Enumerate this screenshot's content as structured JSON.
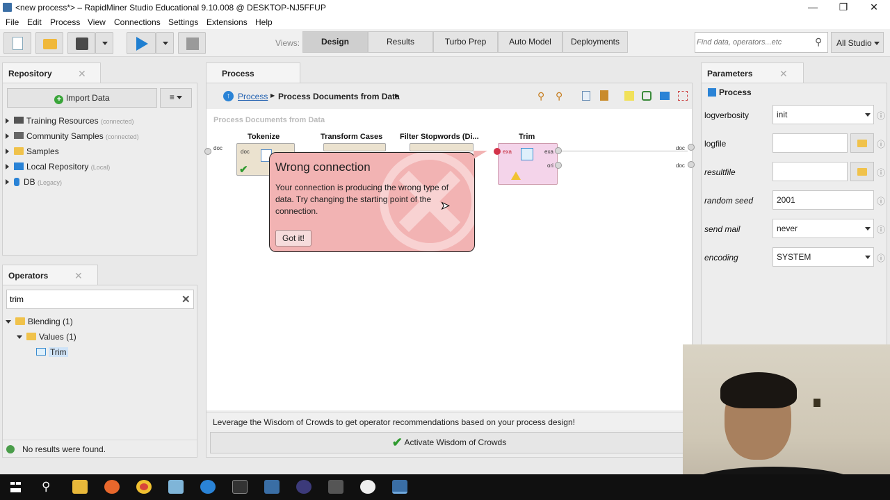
{
  "window": {
    "title": "<new process*> – RapidMiner Studio Educational 9.10.008 @ DESKTOP-NJ5FFUP",
    "controls": [
      "minimize-icon",
      "restore-icon",
      "close-icon"
    ]
  },
  "menu": [
    "File",
    "Edit",
    "Process",
    "View",
    "Connections",
    "Settings",
    "Extensions",
    "Help"
  ],
  "toolbar": {
    "views_label": "Views:",
    "views": [
      "Design",
      "Results",
      "Turbo Prep",
      "Auto Model",
      "Deployments"
    ],
    "active_view": "Design",
    "search_placeholder": "Find data, operators...etc",
    "scope": "All Studio"
  },
  "repository": {
    "title": "Repository",
    "import_label": "Import Data",
    "items": [
      {
        "label": "Training Resources",
        "note": "(connected)",
        "icon": "training-resources-icon"
      },
      {
        "label": "Community Samples",
        "note": "(connected)",
        "icon": "community-samples-icon"
      },
      {
        "label": "Samples",
        "note": "",
        "icon": "folder-icon"
      },
      {
        "label": "Local Repository",
        "note": "(Local)",
        "icon": "local-repository-icon"
      },
      {
        "label": "DB",
        "note": "(Legacy)",
        "icon": "database-icon"
      }
    ]
  },
  "operators": {
    "title": "Operators",
    "search_value": "trim",
    "tree": [
      {
        "label": "Blending (1)",
        "level": 0,
        "icon": "folder-icon"
      },
      {
        "label": "Values (1)",
        "level": 1,
        "icon": "folder-icon"
      },
      {
        "label": "Trim",
        "level": 2,
        "icon": "trim-operator-icon"
      }
    ],
    "status": "No results were found."
  },
  "process": {
    "tab": "Process",
    "breadcrumb": [
      "Process",
      "Process Documents from Data"
    ],
    "canvas_label": "Process Documents from Data",
    "operators": [
      "Tokenize",
      "Transform Cases",
      "Filter Stopwords (Di...",
      "Trim"
    ],
    "port_labels": {
      "doc": "doc",
      "exa": "exa",
      "ori": "ori"
    },
    "tooltip": {
      "title": "Wrong connection",
      "body": "Your connection is producing the wrong type of data. Try changing the starting point of the connection.",
      "button": "Got it!"
    },
    "wisdom_text": "Leverage the Wisdom of Crowds to get operator recommendations based on your process design!",
    "wisdom_button": "Activate Wisdom of Crowds"
  },
  "parameters": {
    "title": "Parameters",
    "operator": "Process",
    "rows": [
      {
        "label": "logverbosity",
        "value": "init",
        "type": "select",
        "italic": false
      },
      {
        "label": "logfile",
        "value": "",
        "type": "file",
        "italic": false
      },
      {
        "label": "resultfile",
        "value": "",
        "type": "file",
        "italic": true
      },
      {
        "label": "random seed",
        "value": "2001",
        "type": "text",
        "italic": true
      },
      {
        "label": "send mail",
        "value": "never",
        "type": "select",
        "italic": true
      },
      {
        "label": "encoding",
        "value": "SYSTEM",
        "type": "select",
        "italic": true
      }
    ]
  },
  "colors": {
    "tooltip_bg": "#f2b3b3",
    "accent_blue": "#1f7fd1",
    "trim_op_bg": "#f4d4ea",
    "green_check": "#4caf50"
  }
}
